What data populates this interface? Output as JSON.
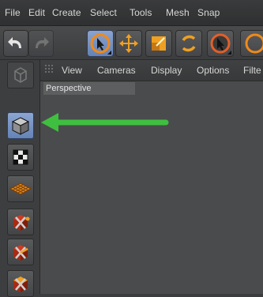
{
  "menubar": {
    "items": [
      "File",
      "Edit",
      "Create",
      "Select",
      "Tools",
      "Mesh",
      "Snap"
    ]
  },
  "toolbar": {
    "buttons": [
      {
        "icon": "undo-icon"
      },
      {
        "icon": "redo-icon"
      },
      {
        "icon": "live-selection-icon"
      },
      {
        "icon": "move-icon"
      },
      {
        "icon": "scale-icon"
      },
      {
        "icon": "rotate-icon"
      },
      {
        "icon": "selection-tool-icon"
      },
      {
        "icon": "tool-icon"
      }
    ]
  },
  "left_panel": {
    "buttons": [
      {
        "icon": "make-editable-icon"
      },
      {
        "icon": "model-mode-cube-icon",
        "selected": true
      },
      {
        "icon": "texture-mode-icon"
      },
      {
        "icon": "workplane-mode-icon"
      },
      {
        "icon": "points-mode-icon"
      },
      {
        "icon": "edges-mode-icon"
      },
      {
        "icon": "polygons-mode-icon"
      }
    ]
  },
  "viewport": {
    "menu": [
      "View",
      "Cameras",
      "Display",
      "Options",
      "Filte"
    ],
    "label": "Perspective"
  },
  "colors": {
    "arrow": "#3fbf3f",
    "selected_button": "#6f8ec3",
    "icon_orange": "#f0a020",
    "icon_red": "#d23a1f"
  }
}
